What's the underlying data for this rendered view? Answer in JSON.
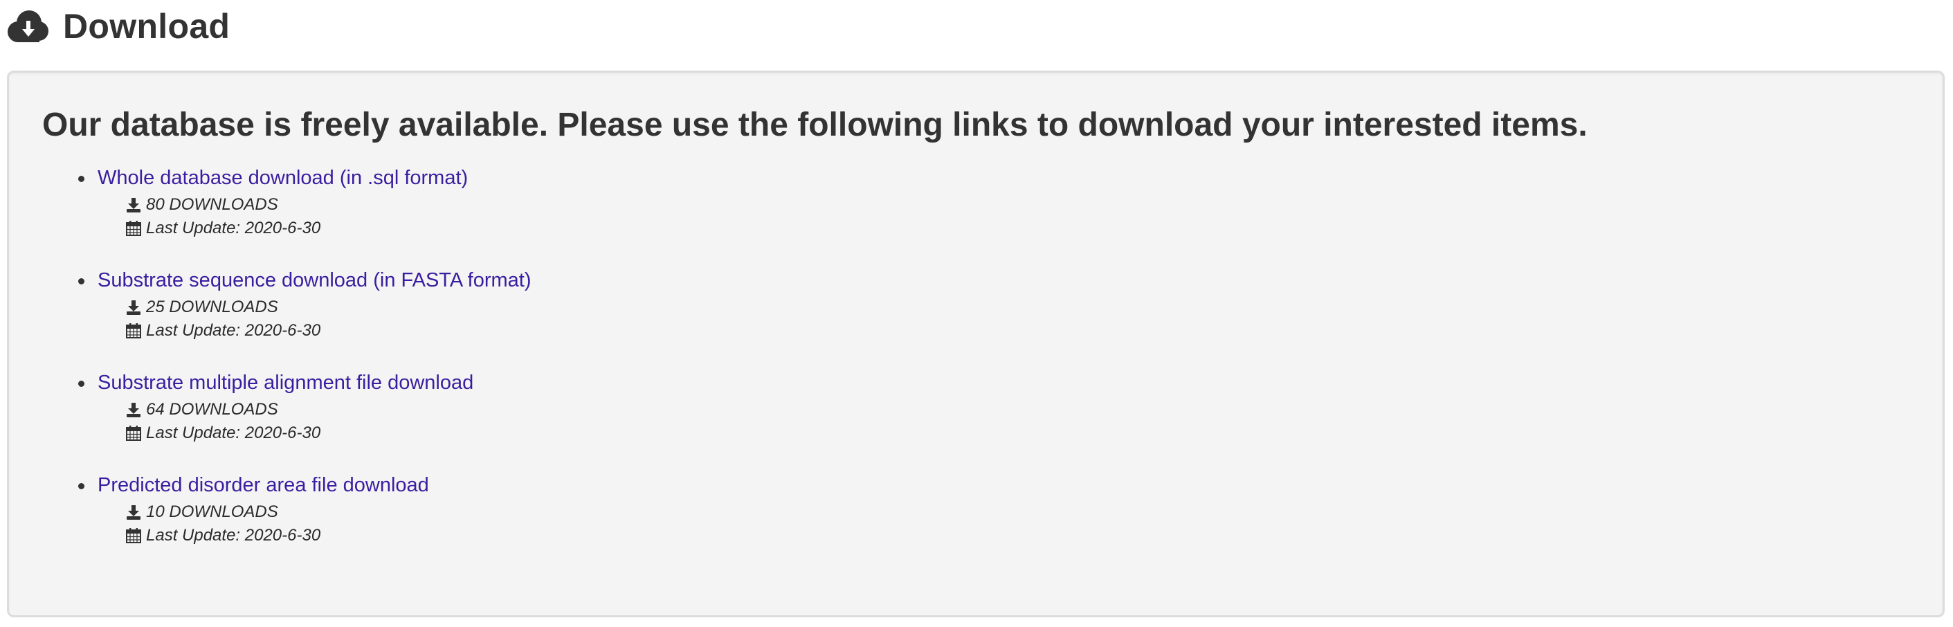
{
  "header": {
    "icon": "cloud-download-icon",
    "title": "Download"
  },
  "intro": "Our database is freely available. Please use the following links to download your interested items.",
  "items": [
    {
      "link": "Whole database download (in .sql format)",
      "downloads": "80 DOWNLOADS",
      "last_update": "Last Update: 2020-6-30"
    },
    {
      "link": "Substrate sequence download (in FASTA format)",
      "downloads": "25 DOWNLOADS",
      "last_update": "Last Update: 2020-6-30"
    },
    {
      "link": "Substrate multiple alignment file download",
      "downloads": "64 DOWNLOADS",
      "last_update": "Last Update: 2020-6-30"
    },
    {
      "link": "Predicted disorder area file download",
      "downloads": "10 DOWNLOADS",
      "last_update": "Last Update: 2020-6-30"
    }
  ],
  "icons": {
    "downloads": "download-icon",
    "last_update": "calendar-icon"
  },
  "colors": {
    "link": "#3a1ea0",
    "text": "#333333",
    "panel_background": "#f4f4f4",
    "panel_border": "#dcdcdc"
  }
}
